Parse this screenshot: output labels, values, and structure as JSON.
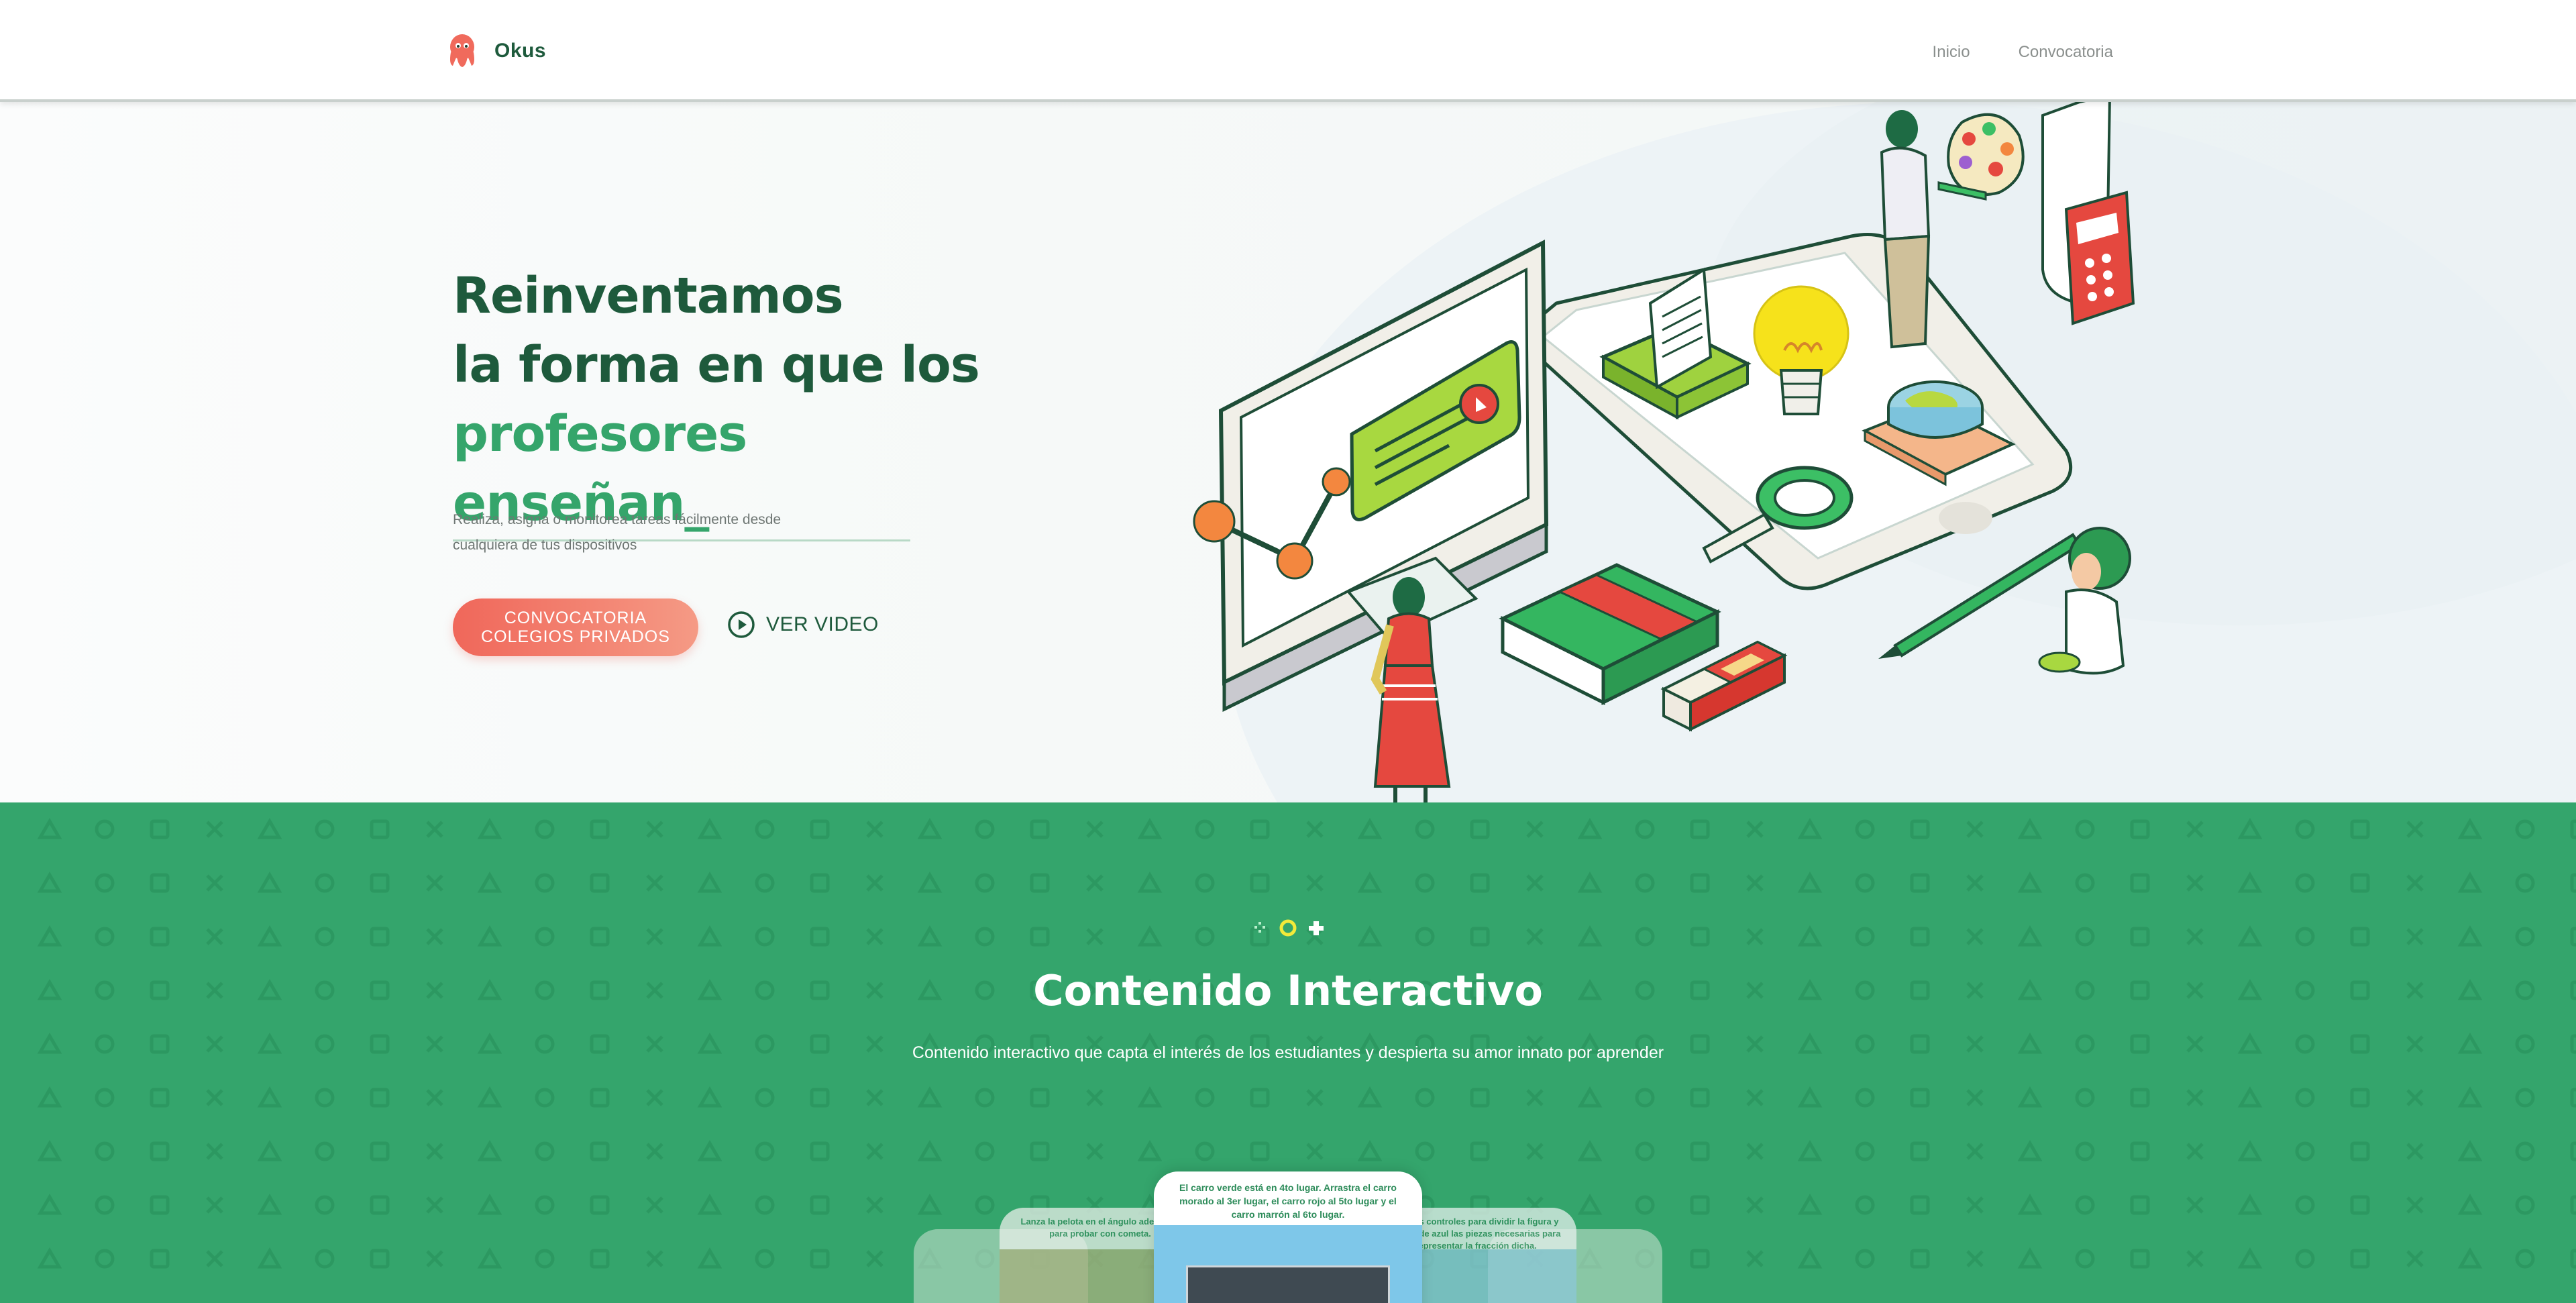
{
  "header": {
    "brand": "Okus",
    "nav": [
      {
        "label": "Inicio"
      },
      {
        "label": "Convocatoria"
      }
    ]
  },
  "hero": {
    "headline_line1": "Reinventamos",
    "headline_line2": "la forma en que los",
    "headline_accent": "profesores enseñan_",
    "subtext_line1": "Realiza, asigna o monitorea tareas fácilmente desde",
    "subtext_line2": "cualquiera de tus dispositivos",
    "cta_line1": "CONVOCATORIA",
    "cta_line2": "COLEGIOS PRIVADOS",
    "video_label": "VER VIDEO"
  },
  "section": {
    "title": "Contenido Interactivo",
    "description": "Contenido interactivo que capta el interés de los estudiantes y despierta su amor innato por aprender"
  },
  "cards": {
    "main_text": "El carro verde está en 4to lugar. Arrastra el carro morado al 3er lugar, el carro rojo al 5to lugar y el carro marrón al 6to lugar.",
    "left_text": "Lanza la pelota en el ángulo adecuado para probar con cometa.",
    "right_text": "Usa los controles para dividir la figura y marca de azul las piezas necesarias para representar la fracción dicha."
  },
  "colors": {
    "brand_dark_green": "#1e5a3c",
    "accent_green": "#35a56b",
    "section_green": "#34a56c",
    "cta_coral": "#f0675a"
  },
  "icons": [
    "octopus-logo-icon",
    "play-circle-icon",
    "decorative-shapes-icon"
  ]
}
